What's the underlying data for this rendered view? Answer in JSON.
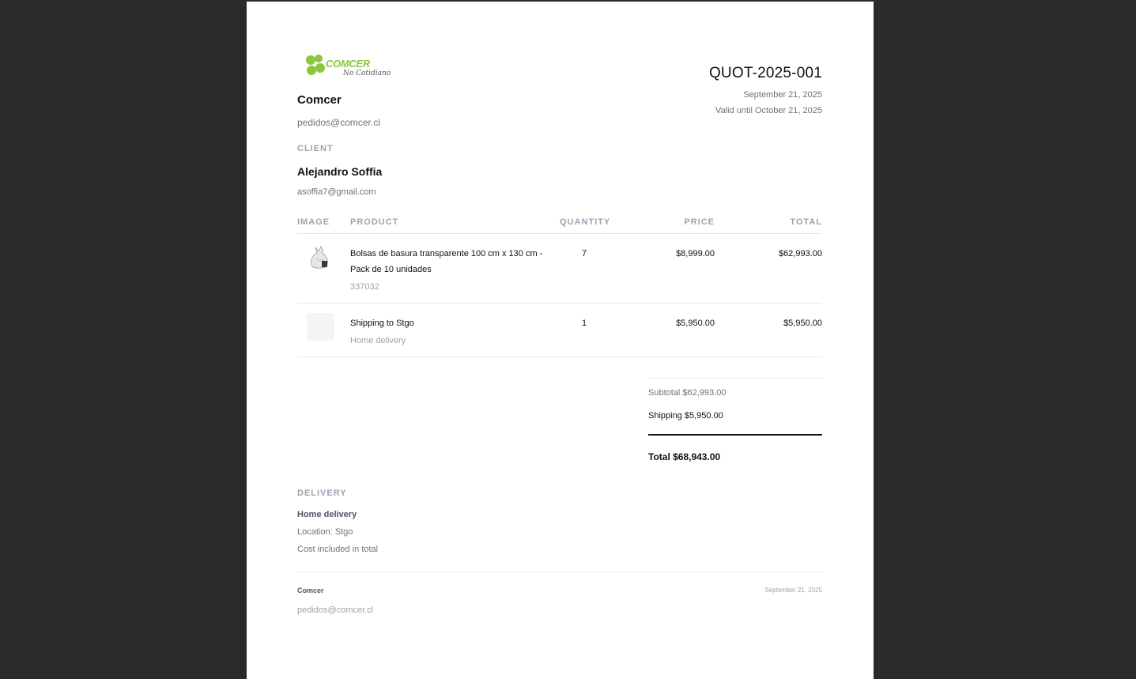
{
  "company": {
    "logo_text": "COMCER",
    "logo_tagline": "No Cotidiano",
    "name": "Comcer",
    "email": "pedidos@comcer.cl"
  },
  "quote": {
    "number": "QUOT-2025-001",
    "date": "September 21, 2025",
    "valid_until": "Valid until October 21, 2025"
  },
  "client": {
    "label": "CLIENT",
    "name": "Alejandro Soffia",
    "email": "asoffia7@gmail.com"
  },
  "table": {
    "headers": {
      "image": "IMAGE",
      "product": "PRODUCT",
      "quantity": "QUANTITY",
      "price": "PRICE",
      "total": "TOTAL"
    },
    "rows": [
      {
        "icon": "trash-bag-image",
        "name": "Bolsas de basura transparente 100 cm x 130 cm - Pack de 10 unidades",
        "sub": "337032",
        "quantity": "7",
        "price": "$8,999.00",
        "total": "$62,993.00"
      },
      {
        "icon": "placeholder-image",
        "name": "Shipping to Stgo",
        "sub": "Home delivery",
        "quantity": "1",
        "price": "$5,950.00",
        "total": "$5,950.00"
      }
    ]
  },
  "summary": {
    "subtotal": "Subtotal $62,993.00",
    "shipping": "Shipping $5,950.00",
    "total": "Total $68,943.00"
  },
  "delivery": {
    "label": "DELIVERY",
    "type": "Home delivery",
    "location": "Location: Stgo",
    "cost_note": "Cost included in total"
  },
  "footer": {
    "name": "Comcer",
    "date": "September 21, 2025",
    "email": "pedidos@comcer.cl"
  },
  "colors": {
    "background": "#2a2a2a",
    "page": "#ffffff",
    "brand_green": "#8dc63f"
  }
}
